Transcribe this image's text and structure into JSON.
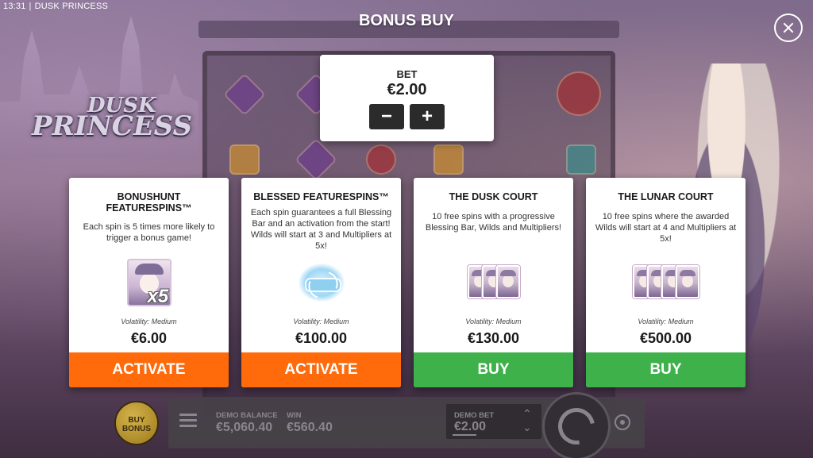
{
  "status_bar": {
    "time": "13:31",
    "separator": "|",
    "game_name": "DUSK PRINCESS"
  },
  "logo": {
    "line1": "DUSK",
    "line2": "PRINCESS"
  },
  "dialog": {
    "title": "BONUS BUY",
    "close_icon": "close-icon"
  },
  "bet": {
    "label": "BET",
    "value": "€2.00",
    "decrease": "−",
    "increase": "+"
  },
  "cards": [
    {
      "title": "BONUSHUNT FEATURESPINS™",
      "description": "Each spin is 5 times more likely to trigger a bonus game!",
      "image_badge": "x5",
      "volatility": "Volatility: Medium",
      "price": "€6.00",
      "action": "ACTIVATE",
      "action_color": "#ff6a0a"
    },
    {
      "title": "BLESSED FEATURESPINS™",
      "description": "Each spin guarantees a full Blessing Bar and an activation from the start! Wilds will start at 3 and Multipliers at 5x!",
      "volatility": "Volatility: Medium",
      "price": "€100.00",
      "action": "ACTIVATE",
      "action_color": "#ff6a0a"
    },
    {
      "title": "THE DUSK COURT",
      "description": "10 free spins with a progressive Blessing Bar, Wilds and Multipliers!",
      "volatility": "Volatility: Medium",
      "price": "€130.00",
      "action": "BUY",
      "action_color": "#3eb14a"
    },
    {
      "title": "THE LUNAR COURT",
      "description": "10 free spins where the awarded Wilds will start at 4 and Multipliers at 5x!",
      "volatility": "Volatility: Medium",
      "price": "€500.00",
      "action": "BUY",
      "action_color": "#3eb14a"
    }
  ],
  "bottom_bar": {
    "buy_bonus_line1": "BUY",
    "buy_bonus_line2": "BONUS",
    "demo_balance_label": "DEMO BALANCE",
    "demo_balance_value": "€5,060.40",
    "win_label": "WIN",
    "win_value": "€560.40",
    "demo_bet_label": "DEMO BET",
    "demo_bet_value": "€2.00",
    "arrow_up": "⌃",
    "arrow_down": "⌄"
  }
}
